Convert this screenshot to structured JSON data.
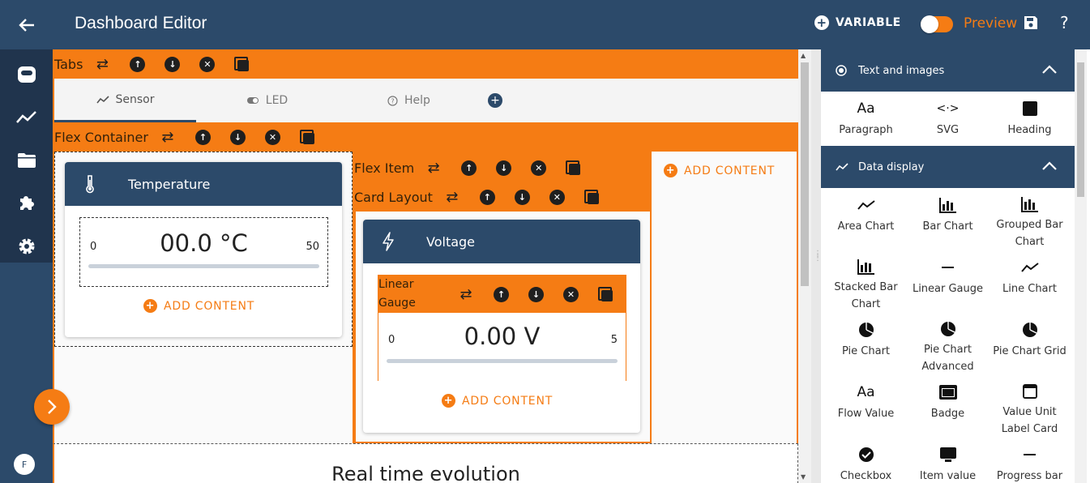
{
  "app": {
    "title": "Dashboard Editor",
    "avatar_initial": "F"
  },
  "topbar": {
    "variable_label": "VARIABLE",
    "preview_label": "Preview",
    "help_label": "?"
  },
  "colors": {
    "accent": "#f57c14",
    "primary": "#2c4a6a",
    "rail_dark": "#20344d"
  },
  "tabs_bar": {
    "label": "Tabs"
  },
  "tabs": [
    {
      "label": "Sensor",
      "icon": "line-chart-icon",
      "active": true
    },
    {
      "label": "LED",
      "icon": "toggle-icon",
      "active": false
    },
    {
      "label": "Help",
      "icon": "help-icon",
      "active": false
    }
  ],
  "flex_container": {
    "label": "Flex Container"
  },
  "flex_item": {
    "label": "Flex Item"
  },
  "card_layout": {
    "label": "Card Layout"
  },
  "add_content_label": "ADD CONTENT",
  "temperature_card": {
    "title": "Temperature",
    "gauge": {
      "min": "0",
      "max": "50",
      "value": "00.0 °C"
    }
  },
  "voltage_card": {
    "title": "Voltage",
    "gauge_label": "Linear Gauge",
    "gauge": {
      "min": "0",
      "max": "5",
      "value": "0.00 V"
    }
  },
  "realtime_title": "Real time evolution",
  "palette": {
    "sections": [
      {
        "title": "Text and images",
        "items": [
          {
            "label": "Paragraph",
            "icon": "text-icon"
          },
          {
            "label": "SVG",
            "icon": "svg-icon"
          },
          {
            "label": "Heading",
            "icon": "heading-icon"
          }
        ]
      },
      {
        "title": "Data display",
        "items": [
          {
            "label": "Area Chart",
            "icon": "area-chart-icon"
          },
          {
            "label": "Bar Chart",
            "icon": "bar-chart-icon"
          },
          {
            "label": "Grouped Bar Chart",
            "icon": "grouped-bar-chart-icon"
          },
          {
            "label": "Stacked Bar Chart",
            "icon": "stacked-bar-chart-icon"
          },
          {
            "label": "Linear Gauge",
            "icon": "linear-gauge-icon"
          },
          {
            "label": "Line Chart",
            "icon": "line-chart-icon"
          },
          {
            "label": "Pie Chart",
            "icon": "pie-chart-icon"
          },
          {
            "label": "Pie Chart Advanced",
            "icon": "pie-chart-advanced-icon"
          },
          {
            "label": "Pie Chart Grid",
            "icon": "pie-chart-grid-icon"
          },
          {
            "label": "Flow Value",
            "icon": "flow-value-icon"
          },
          {
            "label": "Badge",
            "icon": "badge-icon"
          },
          {
            "label": "Value Unit Label Card",
            "icon": "value-unit-card-icon"
          },
          {
            "label": "Checkbox",
            "icon": "checkbox-icon"
          },
          {
            "label": "Item value",
            "icon": "item-value-icon"
          },
          {
            "label": "Progress bar",
            "icon": "progress-bar-icon"
          }
        ]
      }
    ]
  }
}
